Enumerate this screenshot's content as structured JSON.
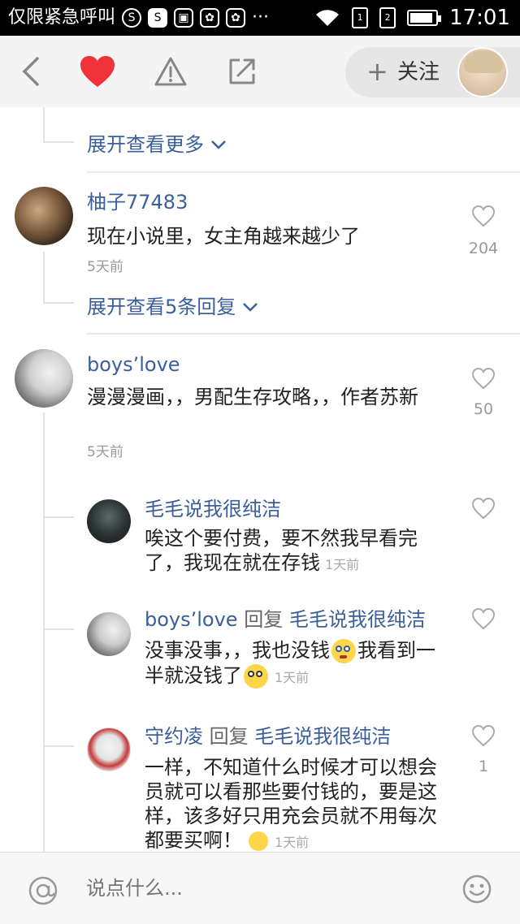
{
  "status_bar": {
    "carrier": "仅限紧急呼叫",
    "time": "17:01",
    "icons": [
      "s-circle-icon",
      "s-red-icon",
      "image-icon",
      "huawei-icon",
      "huawei-icon",
      "more-dots-icon",
      "wifi-icon",
      "sim1-icon",
      "sim2-icon",
      "battery-icon"
    ],
    "more": "···",
    "battery_level": 0.8
  },
  "toolbar": {
    "follow_plus": "+",
    "follow_label": "关注",
    "like_color": "#f0333a"
  },
  "comments": {
    "expand_more": "展开查看更多",
    "c1": {
      "user": "柚子77483",
      "text": "现在小说里，女主角越来越少了",
      "time": "5天前",
      "likes": "204",
      "expand": "展开查看5条回复"
    },
    "c2": {
      "user": "boys’love",
      "text": "漫漫漫画，，男配生存攻略，，作者苏新",
      "time": "5天前",
      "likes": "50",
      "replies": [
        {
          "user": "毛毛说我很纯洁",
          "text": "唉这个要付费，要不然我早看完了，我现在就在存钱",
          "time": "1天前"
        },
        {
          "user": "boys’love",
          "reply_word": "回复",
          "target": "毛毛说我很纯洁",
          "text_a": "没事没事，，我也没钱",
          "text_b": "我看到一半就没钱了",
          "time": "1天前"
        },
        {
          "user": "守约凌",
          "reply_word": "回复",
          "target": "毛毛说我很纯洁",
          "text": "一样，不知道什么时候才可以想会员就可以看那些要付钱的，要是这样，该多好只用充会员就不用每次都要买啊！",
          "time": "1天前",
          "likes": "1"
        }
      ]
    }
  },
  "composer": {
    "placeholder": "说点什么..."
  }
}
